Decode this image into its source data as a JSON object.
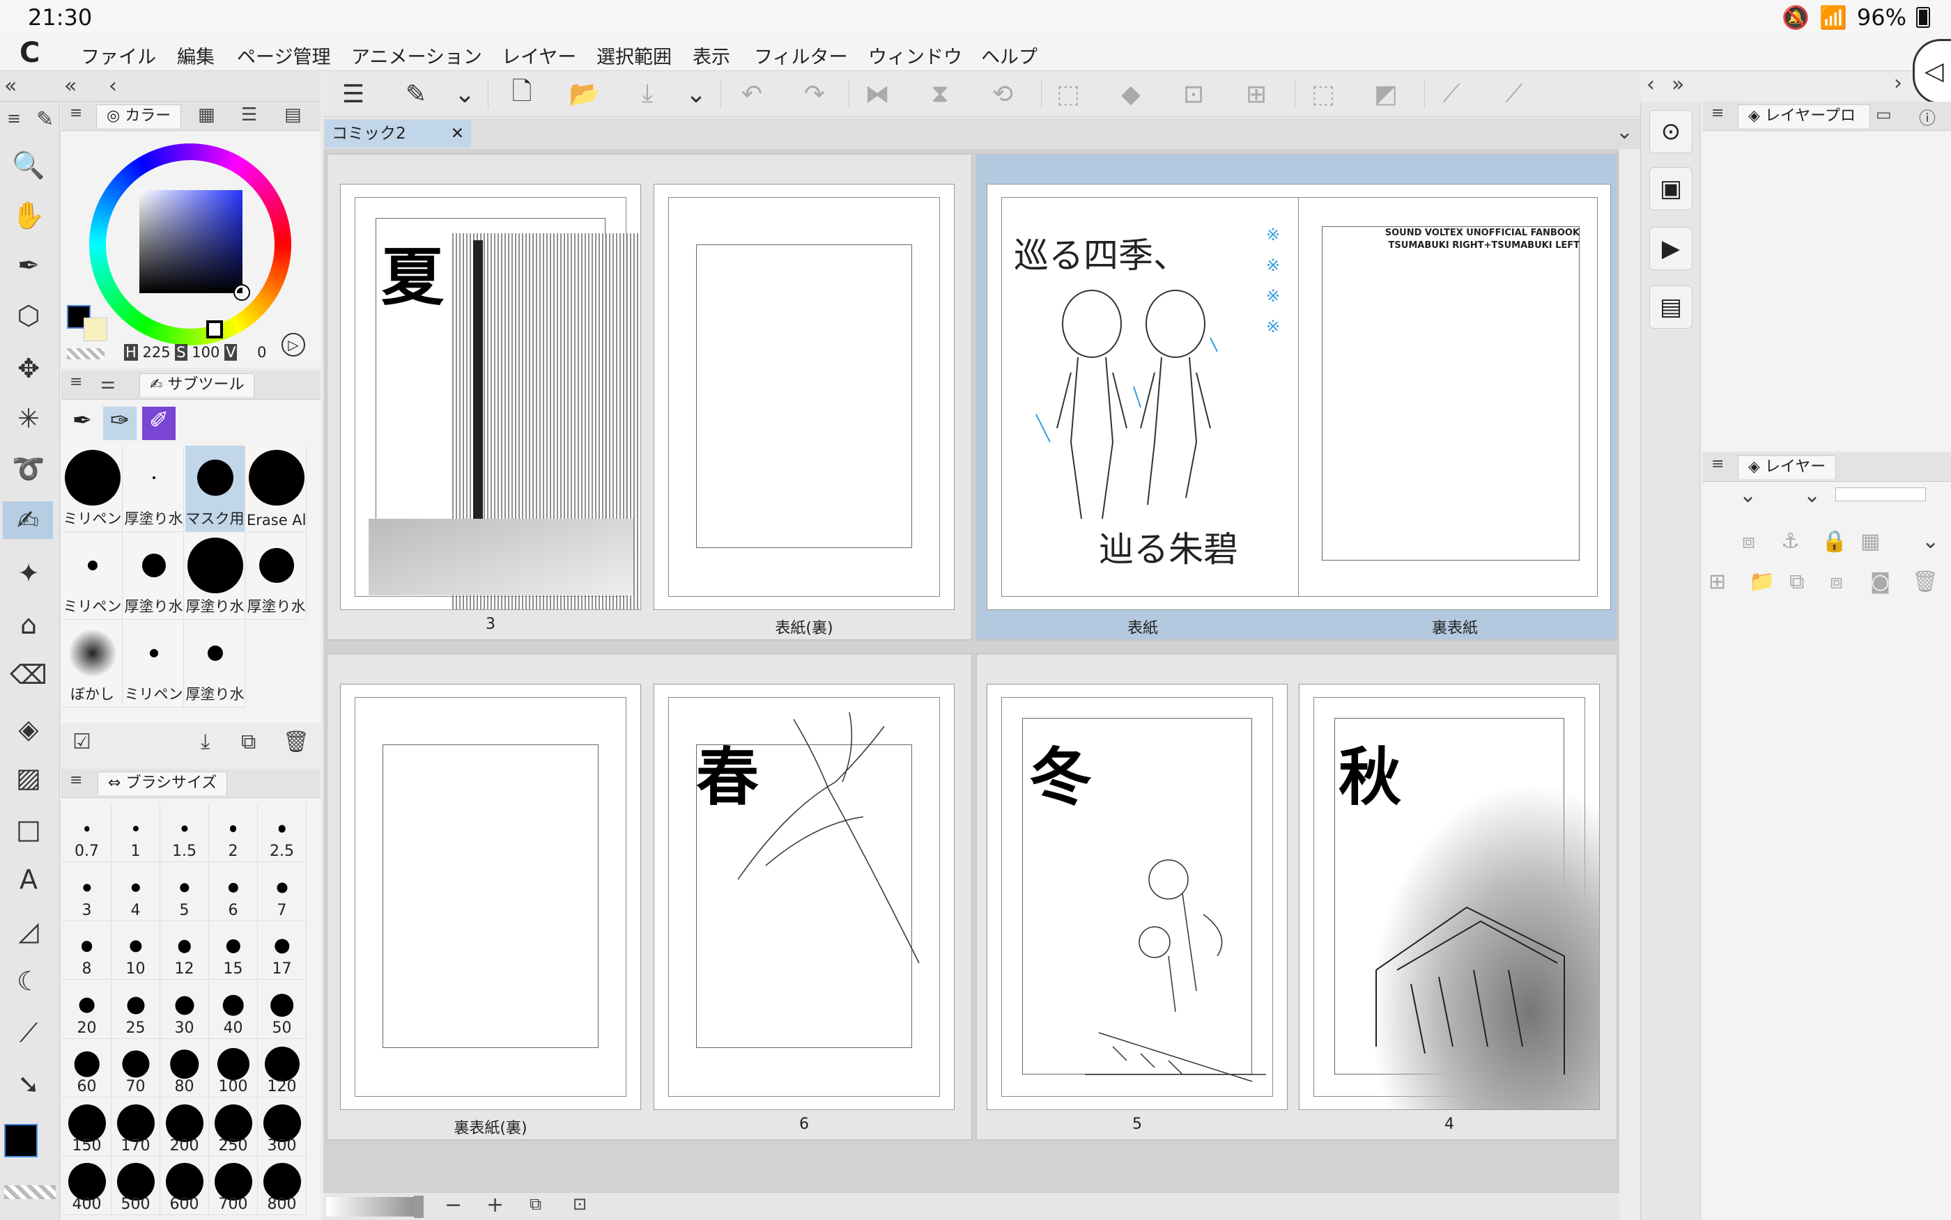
{
  "status": {
    "time": "21:30",
    "battery": "96%"
  },
  "menu": [
    "ファイル",
    "編集",
    "ページ管理",
    "アニメーション",
    "レイヤー",
    "選択範囲",
    "表示",
    "フィルター",
    "ウィンドウ",
    "ヘルプ"
  ],
  "color_panel": {
    "tab_label": "カラー",
    "h_label": "H",
    "h": "225",
    "s_label": "S",
    "s": "100",
    "v_label": "V",
    "v": "0",
    "main_color": "#000000",
    "sub_color": "#f8f0c0"
  },
  "subtool_panel": {
    "tab_label": "サブツール",
    "brushes": [
      {
        "label": "ミリペン",
        "size": 80,
        "selected": false
      },
      {
        "label": "厚塗り水",
        "size": 4,
        "selected": false
      },
      {
        "label": "マスク用",
        "size": 52,
        "selected": true
      },
      {
        "label": "Erase Al",
        "size": 80,
        "selected": false
      },
      {
        "label": "ミリペン",
        "size": 14,
        "selected": false
      },
      {
        "label": "厚塗り水",
        "size": 34,
        "selected": false
      },
      {
        "label": "厚塗り水",
        "size": 80,
        "selected": false
      },
      {
        "label": "厚塗り水",
        "size": 50,
        "selected": false
      },
      {
        "label": "ぼかし",
        "size": 70,
        "selected": false
      },
      {
        "label": "ミリペン",
        "size": 12,
        "selected": false
      },
      {
        "label": "厚塗り水",
        "size": 22,
        "selected": false
      }
    ]
  },
  "brush_size_panel": {
    "tab_label": "ブラシサイズ",
    "sizes": [
      "0.7",
      "1",
      "1.5",
      "2",
      "2.5",
      "3",
      "4",
      "5",
      "6",
      "7",
      "8",
      "10",
      "12",
      "15",
      "17",
      "20",
      "25",
      "30",
      "40",
      "50",
      "60",
      "70",
      "80",
      "100",
      "120",
      "150",
      "170",
      "200",
      "250",
      "300",
      "400",
      "500",
      "600",
      "700",
      "800"
    ]
  },
  "document": {
    "tab_title": "コミック2",
    "pages": {
      "p3": "3",
      "cover_back_inner": "表紙(裏)",
      "cover": "表紙",
      "back_cover": "裏表紙",
      "back_cover_inner": "裏表紙(裏)",
      "p6": "6",
      "p5": "5",
      "p4": "4"
    },
    "page_kanji": {
      "summer": "夏",
      "spring": "春",
      "winter": "冬",
      "autumn": "秋"
    },
    "cover_text": {
      "title_line1": "巡る四季、",
      "title_line2": "辿る朱碧",
      "fanbook_line1": "SOUND VOLTEX UNOFFICIAL FANBOOK",
      "fanbook_line2": "TSUMABUKI RIGHT+TSUMABUKI LEFT"
    }
  },
  "right_panel": {
    "layer_property_tab": "レイヤープロ",
    "layer_tab": "レイヤー"
  }
}
